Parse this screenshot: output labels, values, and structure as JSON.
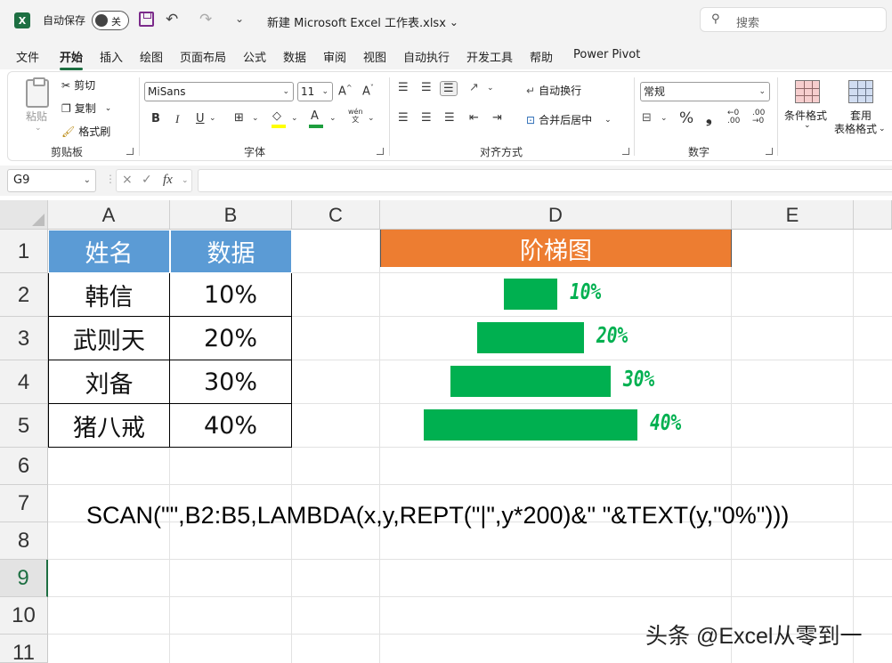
{
  "titlebar": {
    "app_logo": "X",
    "autosave_label": "自动保存",
    "autosave_state": "关",
    "filename": "新建 Microsoft Excel 工作表.xlsx",
    "filename_dropdown": "⌄",
    "undo_icon": "↶",
    "redo_icon": "↷",
    "customize_icon": "⌄",
    "search_icon": "⚲",
    "search_placeholder": "搜索"
  },
  "tabs": [
    "文件",
    "开始",
    "插入",
    "绘图",
    "页面布局",
    "公式",
    "数据",
    "审阅",
    "视图",
    "自动执行",
    "开发工具",
    "帮助",
    "Power Pivot"
  ],
  "active_tab": "开始",
  "ribbon": {
    "clipboard": {
      "paste": "粘贴",
      "cut": "剪切",
      "copy": "复制",
      "format_painter": "格式刷",
      "label": "剪贴板"
    },
    "font": {
      "font_name": "MiSans",
      "font_size": "11",
      "grow": "A^",
      "shrink": "A˅",
      "bold": "B",
      "italic": "I",
      "underline": "U",
      "phonetic": "wén",
      "phonetic_char": "文",
      "label": "字体"
    },
    "alignment": {
      "wrap_text": "自动换行",
      "merge_center": "合并后居中",
      "label": "对齐方式"
    },
    "number": {
      "format": "常规",
      "percent": "%",
      "comma": "❟",
      "label": "数字"
    },
    "styles": {
      "conditional": "条件格式",
      "table_format_1": "套用",
      "table_format_2": "表格格式"
    }
  },
  "formula_bar": {
    "name_box": "G9",
    "cancel": "×",
    "enter": "✓",
    "fx": "fx",
    "content": ""
  },
  "sheet": {
    "columns": [
      "A",
      "B",
      "C",
      "D",
      "E"
    ],
    "rows": [
      "1",
      "2",
      "3",
      "4",
      "5",
      "6",
      "7",
      "8",
      "9",
      "10",
      "11"
    ],
    "selected_row": "9",
    "table": {
      "headers": [
        "姓名",
        "数据"
      ],
      "rows": [
        [
          "韩信",
          "10%"
        ],
        [
          "武则天",
          "20%"
        ],
        [
          "刘备",
          "30%"
        ],
        [
          "猪八戒",
          "40%"
        ]
      ]
    },
    "ladder_header": "阶梯图",
    "ladder_values": [
      0.1,
      0.2,
      0.3,
      0.4
    ],
    "ladder_labels": [
      "10%",
      "20%",
      "30%",
      "40%"
    ],
    "bar_color": "#00b050",
    "header_blue": "#5b9bd5",
    "header_orange": "#ed7d31",
    "formula_text": "SCAN(\"\",B2:B5,LAMBDA(x,y,REPT(\"|\",y*200)&\" \"&TEXT(y,\"0%\")))",
    "watermark": "头条 @Excel从零到一"
  }
}
